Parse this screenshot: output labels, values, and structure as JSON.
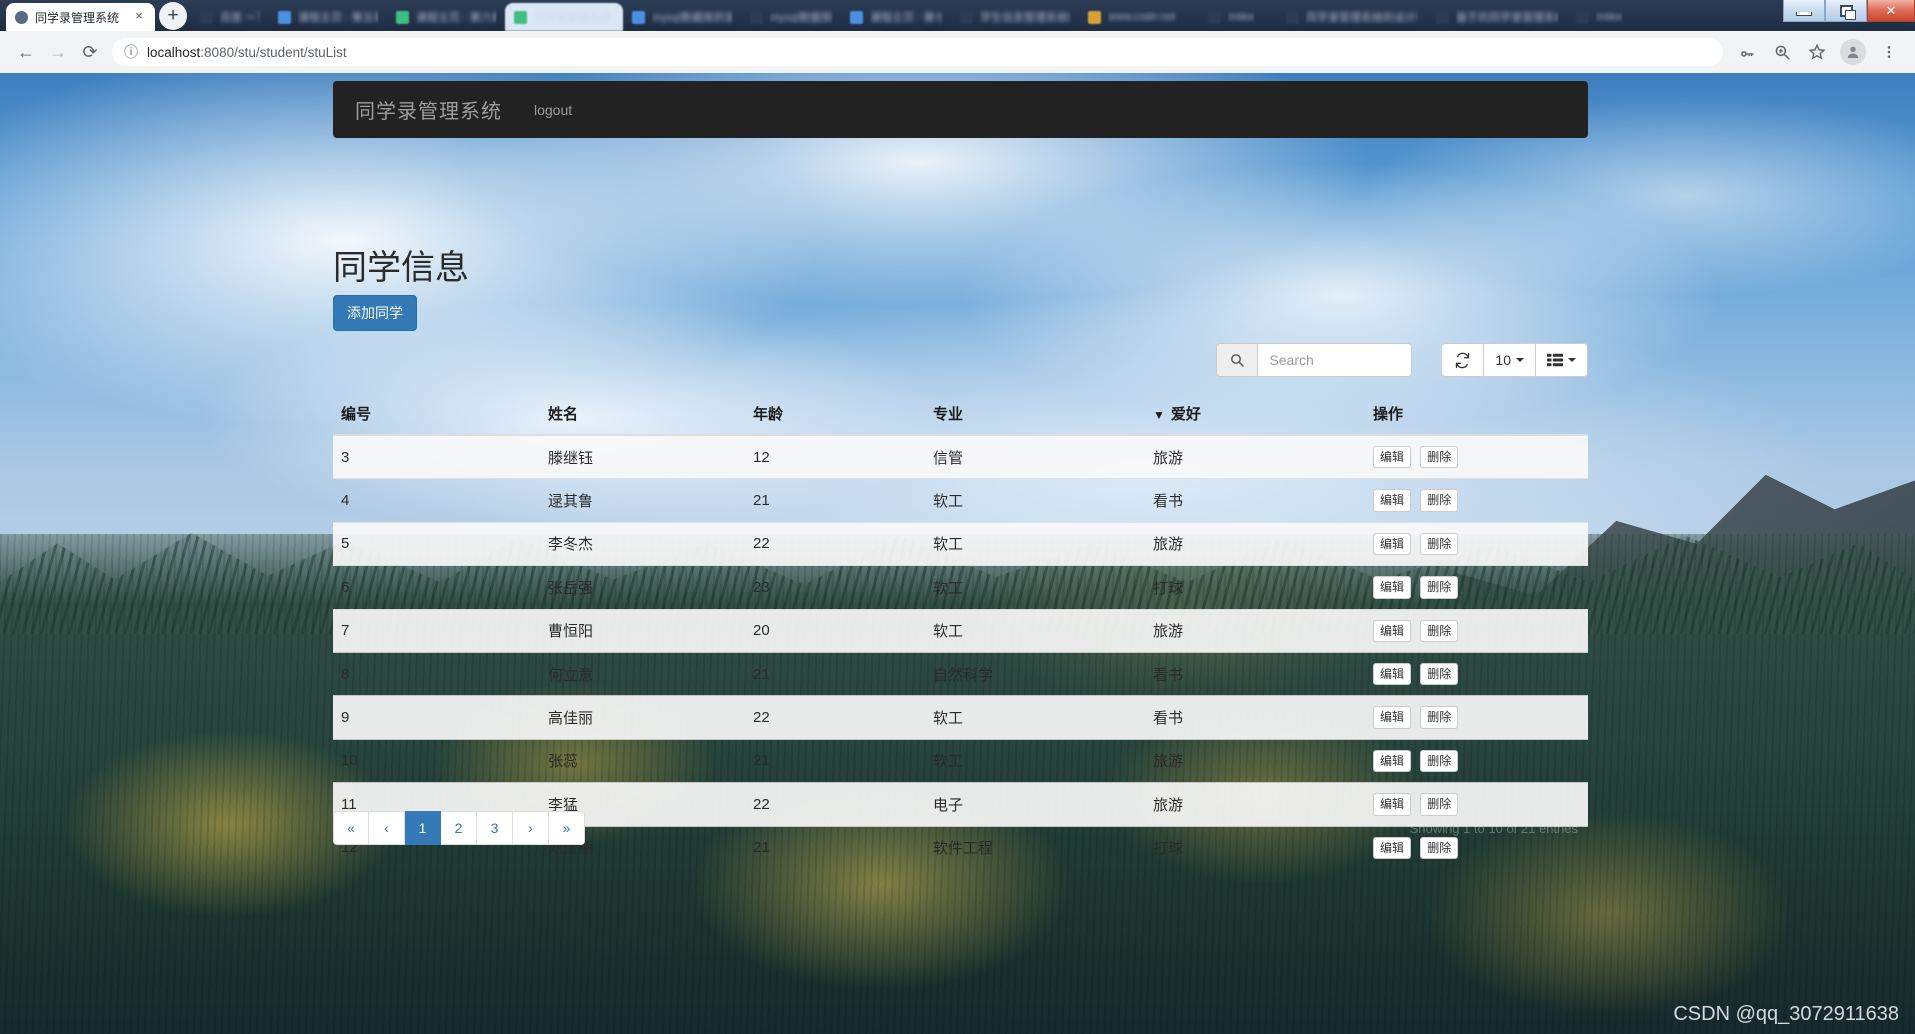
{
  "browser": {
    "tabs": [
      {
        "title": "同学录管理系统",
        "state": "active",
        "favicon": "#5b6b7f"
      },
      {
        "title": "百度 一下",
        "state": "blurred",
        "favicon": "#2b3c55"
      },
      {
        "title": "课程主页 - 第五章",
        "state": "blurred",
        "favicon": "#4a90e2"
      },
      {
        "title": "课程主页 - 第六章",
        "state": "blurred",
        "favicon": "#3fbf7f"
      },
      {
        "title": "同学录管理系统",
        "state": "semiactive",
        "favicon": "#3fbf7f"
      },
      {
        "title": "mysql数据库的安装",
        "state": "blurred",
        "favicon": "#4a90e2"
      },
      {
        "title": "mysql数据库教程",
        "state": "blurred",
        "favicon": "#2b3c55"
      },
      {
        "title": "课程主页 - 第七章",
        "state": "blurred",
        "favicon": "#4a90e2"
      },
      {
        "title": "学生信息管理系统设计",
        "state": "blurred",
        "favicon": "#2b3c55"
      },
      {
        "title": "www.csdn.net",
        "state": "blurred",
        "favicon": "#d8a23a"
      },
      {
        "title": "index",
        "state": "blurred",
        "favicon": "#2b3c55"
      },
      {
        "title": "同学录管理系统的设计与实现",
        "state": "blurred",
        "favicon": "#2b3c55"
      },
      {
        "title": "基于的同学录管理系统",
        "state": "blurred",
        "favicon": "#2b3c55"
      },
      {
        "title": "index",
        "state": "blurred",
        "favicon": "#2b3c55"
      }
    ],
    "new_tab_label": "+",
    "tab_close_label": "×",
    "back_label": "←",
    "forward_label": "→",
    "reload_label": "⟳",
    "site_info_label": "ⓘ",
    "url_host": "localhost",
    "url_path": ":8080/stu/student/stuList",
    "toolbar_icons": [
      "key-icon",
      "zoom-icon",
      "bookmark-star-icon",
      "profile-avatar",
      "chrome-menu-icon"
    ],
    "window_controls": {
      "minimize": "–",
      "restore": "❐",
      "close": "✕"
    }
  },
  "navbar": {
    "brand": "同学录管理系统",
    "links": [
      "logout"
    ]
  },
  "page": {
    "title": "同学信息",
    "add_button": "添加同学"
  },
  "toolbar": {
    "search_placeholder": "Search",
    "search_value": "",
    "refresh_label": "⟳",
    "page_size": "10",
    "columns_label": ""
  },
  "table": {
    "columns": [
      {
        "key": "id",
        "label": "编号",
        "sorted": false
      },
      {
        "key": "name",
        "label": "姓名",
        "sorted": false
      },
      {
        "key": "age",
        "label": "年龄",
        "sorted": false
      },
      {
        "key": "major",
        "label": "专业",
        "sorted": false
      },
      {
        "key": "hobby",
        "label": "爱好",
        "sorted": true
      },
      {
        "key": "ops",
        "label": "操作",
        "sorted": false
      }
    ],
    "sort_caret": "▼",
    "row_actions": {
      "edit": "编辑",
      "delete": "删除"
    },
    "rows": [
      {
        "id": "3",
        "name": "滕继钰",
        "age": "12",
        "major": "信管",
        "hobby": "旅游"
      },
      {
        "id": "4",
        "name": "逯其鲁",
        "age": "21",
        "major": "软工",
        "hobby": "看书"
      },
      {
        "id": "5",
        "name": "李冬杰",
        "age": "22",
        "major": "软工",
        "hobby": "旅游"
      },
      {
        "id": "6",
        "name": "张岳强",
        "age": "23",
        "major": "软工",
        "hobby": "打球"
      },
      {
        "id": "7",
        "name": "曹恒阳",
        "age": "20",
        "major": "软工",
        "hobby": "旅游"
      },
      {
        "id": "8",
        "name": "何立意",
        "age": "21",
        "major": "自然科学",
        "hobby": "看书"
      },
      {
        "id": "9",
        "name": "高佳丽",
        "age": "22",
        "major": "软工",
        "hobby": "看书"
      },
      {
        "id": "10",
        "name": "张蕊",
        "age": "21",
        "major": "软工",
        "hobby": "旅游"
      },
      {
        "id": "11",
        "name": "李猛",
        "age": "22",
        "major": "电子",
        "hobby": "旅游"
      },
      {
        "id": "12",
        "name": "刘雪丽",
        "age": "21",
        "major": "软件工程",
        "hobby": "打球"
      }
    ]
  },
  "pagination": {
    "items": [
      {
        "label": "«",
        "active": false
      },
      {
        "label": "‹",
        "active": false
      },
      {
        "label": "1",
        "active": true
      },
      {
        "label": "2",
        "active": false
      },
      {
        "label": "3",
        "active": false
      },
      {
        "label": "›",
        "active": false
      },
      {
        "label": "»",
        "active": false
      }
    ],
    "showing_text": "Showing 1 to 10 of 21 entries"
  },
  "watermark": "CSDN @qq_3072911638"
}
